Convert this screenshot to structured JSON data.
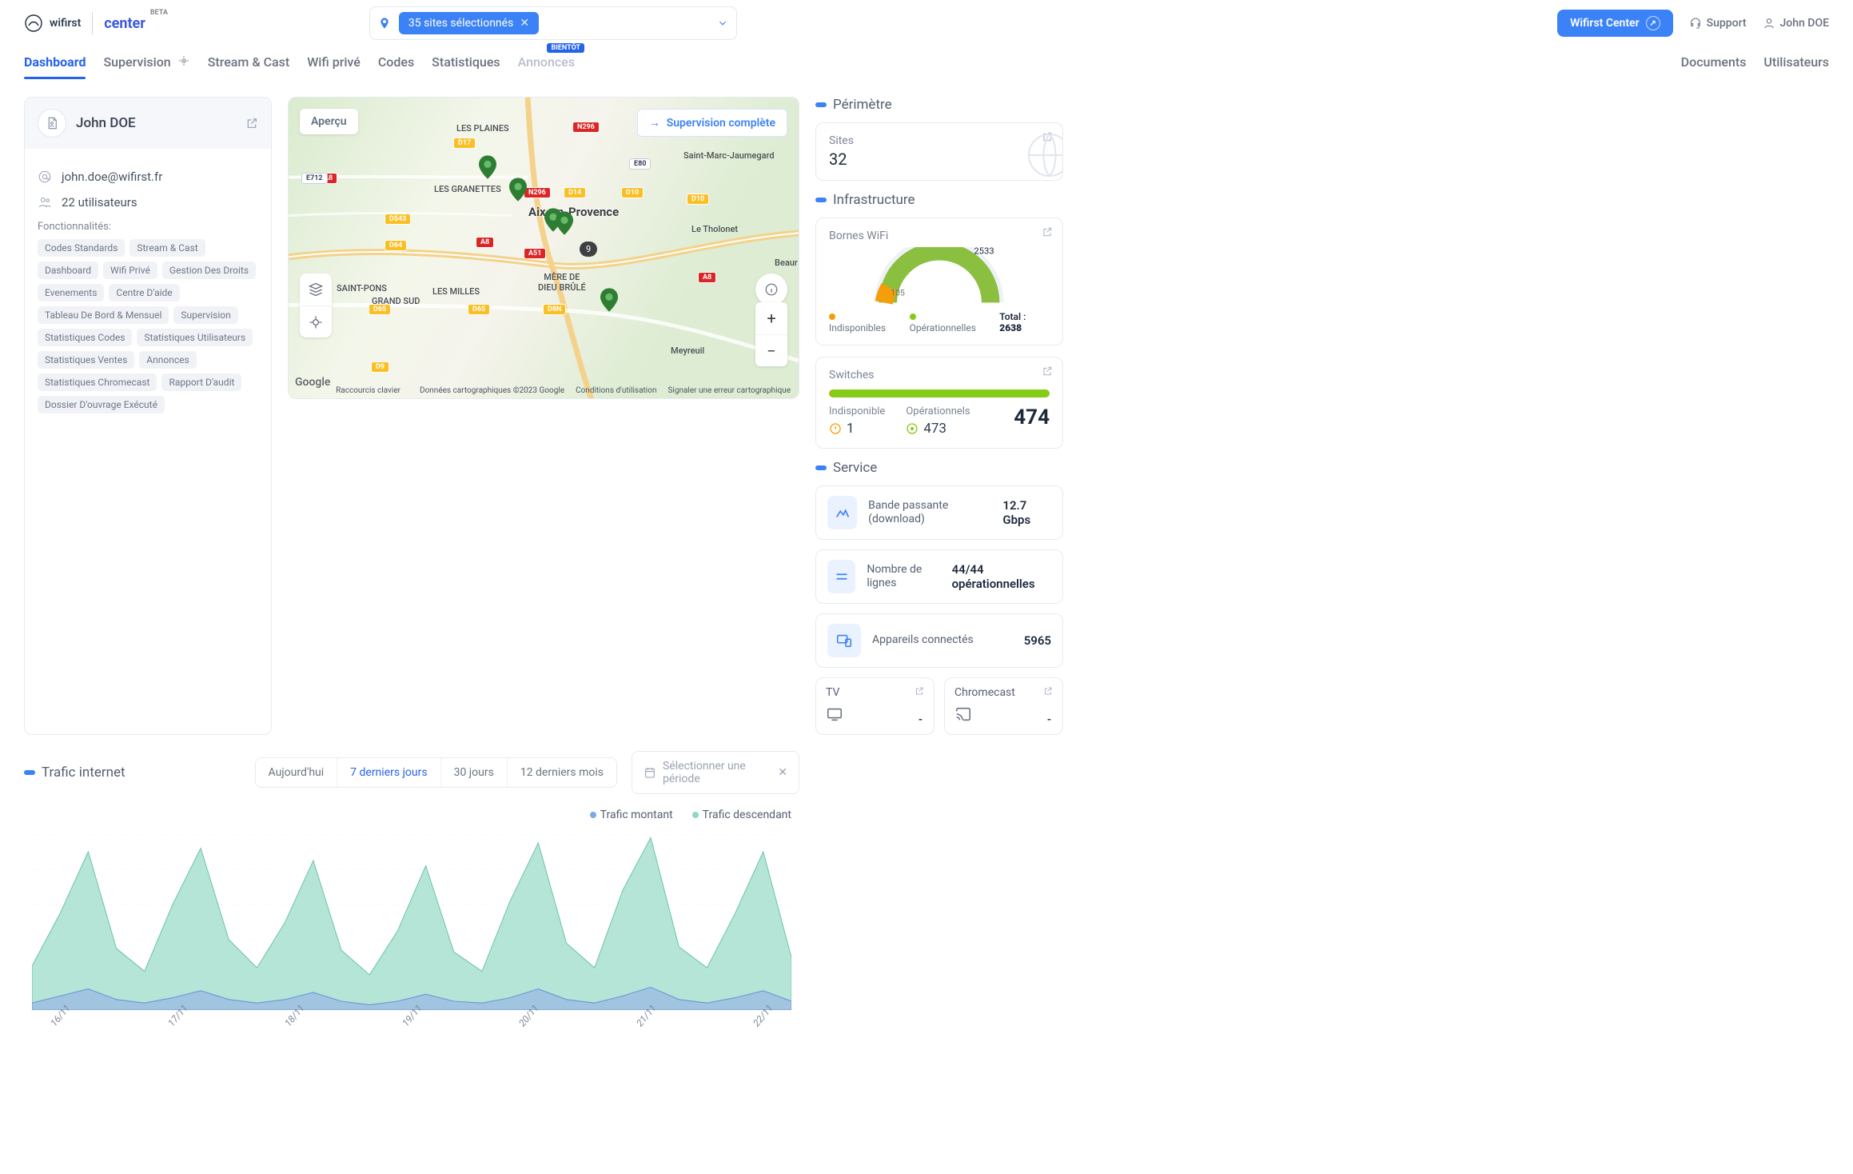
{
  "brand": {
    "name": "wifirst",
    "product": "center",
    "beta": "BETA"
  },
  "sites_chip": "35 sites sélectionnés",
  "topbar": {
    "wifirst_center": "Wifirst Center",
    "support": "Support",
    "user": "John DOE"
  },
  "nav": {
    "dashboard": "Dashboard",
    "supervision": "Supervision",
    "stream": "Stream & Cast",
    "wifi_prive": "Wifi privé",
    "codes": "Codes",
    "stats": "Statistiques",
    "annonces": "Annonces",
    "annonces_badge": "BIENTÔT",
    "documents": "Documents",
    "utilisateurs": "Utilisateurs"
  },
  "profile": {
    "name": "John DOE",
    "email": "john.doe@wifirst.fr",
    "users_count": "22 utilisateurs",
    "features_label": "Fonctionnalités:",
    "features": [
      "Codes Standards",
      "Stream & Cast",
      "Dashboard",
      "Wifi Privé",
      "Gestion Des Droits",
      "Evenements",
      "Centre D'aide",
      "Tableau De Bord & Mensuel",
      "Supervision",
      "Statistiques Codes",
      "Statistiques Utilisateurs",
      "Statistiques Ventes",
      "Annonces",
      "Statistiques Chromecast",
      "Rapport D'audit",
      "Dossier D'ouvrage Exécuté"
    ]
  },
  "map": {
    "apercu": "Aperçu",
    "supervision_btn": "Supervision complète",
    "city": "Aix-en-Provence",
    "towns": [
      "LES PLAINES",
      "LES GRANETTES",
      "SAINT-PONS",
      "GRAND SUD",
      "LES MILLES",
      "MÈRE DE\nDIEU BRÛLÉ",
      "Saint-Marc-Jaumegard",
      "Le Tholonet",
      "Meyreuil",
      "Beaur"
    ],
    "cluster": "9",
    "roads": {
      "n296": "N296",
      "d17": "D17",
      "d14": "D14",
      "d10": "D10",
      "d543": "D543",
      "d64": "D64",
      "d9": "D9",
      "d65": "D65",
      "d8n": "D8N",
      "a8": "A8",
      "a51": "A51",
      "e80": "E80",
      "e712": "E712"
    },
    "footer": [
      "Raccourcis clavier",
      "Données cartographiques ©2023 Google",
      "Conditions d'utilisation",
      "Signaler une erreur cartographique"
    ]
  },
  "perimetre": {
    "head": "Périmètre",
    "sites_label": "Sites",
    "sites_value": "32"
  },
  "infra": {
    "head": "Infrastructure",
    "bornes_title": "Bornes WiFi",
    "indispo_label": "Indisponibles",
    "op_label": "Opérationnelles",
    "indispo_val": "105",
    "op_val": "2533",
    "total_label": "Total :",
    "total_val": "2638",
    "switches_title": "Switches",
    "sw_indispo_label": "Indisponible",
    "sw_op_label": "Opérationnels",
    "sw_indispo_val": "1",
    "sw_op_val": "473",
    "sw_total": "474"
  },
  "service": {
    "head": "Service",
    "bw_label": "Bande passante (download)",
    "bw_val": "12.7 Gbps",
    "lines_label": "Nombre de lignes",
    "lines_val": "44/44 opérationnelles",
    "devices_label": "Appareils connectés",
    "devices_val": "5965",
    "tv_label": "TV",
    "tv_val": "-",
    "cc_label": "Chromecast",
    "cc_val": "-"
  },
  "traffic": {
    "head": "Trafic internet",
    "seg": [
      "Aujourd'hui",
      "7 derniers jours",
      "30 jours",
      "12 derniers mois"
    ],
    "seg_active": 1,
    "period_placeholder": "Sélectionner une période",
    "legend_up": "Trafic montant",
    "legend_down": "Trafic descendant",
    "axis": [
      "16/11",
      "17/11",
      "18/11",
      "19/11",
      "20/11",
      "21/11",
      "22/11"
    ]
  },
  "chart_data": {
    "type": "area",
    "x": [
      0,
      1,
      2,
      3,
      4,
      5,
      6,
      7,
      8,
      9,
      10,
      11,
      12,
      13,
      14,
      15,
      16,
      17,
      18,
      19,
      20,
      21,
      22,
      23,
      24,
      25,
      26,
      27
    ],
    "series": [
      {
        "name": "Trafic descendant",
        "color": "#8fd6c3",
        "values": [
          25,
          55,
          90,
          35,
          22,
          60,
          92,
          40,
          24,
          50,
          85,
          34,
          20,
          45,
          82,
          33,
          22,
          62,
          95,
          38,
          24,
          68,
          98,
          36,
          24,
          55,
          90,
          30
        ]
      },
      {
        "name": "Trafic montant",
        "color": "#7aa9e6",
        "values": [
          4,
          8,
          12,
          6,
          4,
          7,
          11,
          6,
          4,
          6,
          10,
          5,
          3,
          5,
          9,
          5,
          4,
          7,
          12,
          6,
          4,
          8,
          13,
          6,
          4,
          7,
          11,
          5
        ]
      }
    ],
    "ylim": [
      0,
      100
    ],
    "x_categories": [
      "16/11",
      "17/11",
      "18/11",
      "19/11",
      "20/11",
      "21/11",
      "22/11"
    ]
  }
}
